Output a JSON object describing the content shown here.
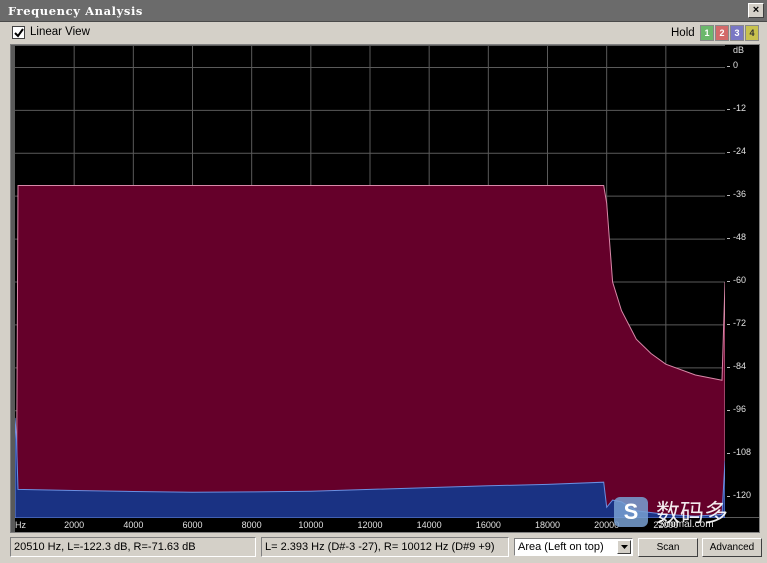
{
  "window": {
    "title": "Frequency Analysis",
    "close_label": "×"
  },
  "toolbar": {
    "linear_view_label": "Linear View",
    "linear_view_checked": true,
    "hold_label": "Hold",
    "hold_buttons": [
      "1",
      "2",
      "3",
      "4"
    ]
  },
  "y_axis": {
    "unit": "dB",
    "labels": [
      "0",
      "-12",
      "-24",
      "-36",
      "-48",
      "-60",
      "-72",
      "-84",
      "-96",
      "-108",
      "-120"
    ]
  },
  "x_axis": {
    "unit": "Hz",
    "labels": [
      "2000",
      "4000",
      "6000",
      "8000",
      "10000",
      "12000",
      "14000",
      "16000",
      "18000",
      "20000",
      "22000"
    ]
  },
  "chart_data": {
    "type": "area",
    "xlabel": "Hz",
    "ylabel": "dB",
    "xlim": [
      0,
      24000
    ],
    "ylim": [
      -126,
      6
    ],
    "grid": true,
    "series": [
      {
        "color": "#65002a",
        "x": [
          50,
          100,
          5000,
          10000,
          15000,
          19900,
          20000,
          20200,
          20500,
          21000,
          21500,
          22000,
          23000,
          23900,
          24000
        ],
        "y": [
          -120,
          -33,
          -33,
          -33,
          -33,
          -33,
          -38,
          -60,
          -68,
          -76,
          -80,
          -83,
          -86,
          -87.5,
          -60
        ]
      },
      {
        "color": "#1a3283",
        "x": [
          0,
          50,
          100,
          2000,
          4000,
          6000,
          8000,
          10000,
          12000,
          14000,
          16000,
          18000,
          19900,
          20000,
          20200,
          20500,
          21000,
          22000,
          23000,
          23900,
          24000
        ],
        "y": [
          -98,
          -104,
          -118,
          -118.3,
          -118.6,
          -118.8,
          -118.7,
          -118.5,
          -118,
          -117.5,
          -117,
          -116.6,
          -116,
          -123,
          -121,
          -121.5,
          -124,
          -125,
          -125.5,
          -125,
          -110
        ]
      }
    ]
  },
  "status": {
    "readout_cursor": "20510 Hz, L=-122.3 dB, R=-71.63 dB",
    "readout_peak": "L=  2.393 Hz (D#-3 -27), R=  10012 Hz (D#9 +9)",
    "mode_select": "Area (Left on top)",
    "scan_label": "Scan",
    "advanced_label": "Advanced"
  },
  "watermark": {
    "logo_letter": "S",
    "text_cn": "数码多",
    "url": "Soomal.com"
  }
}
